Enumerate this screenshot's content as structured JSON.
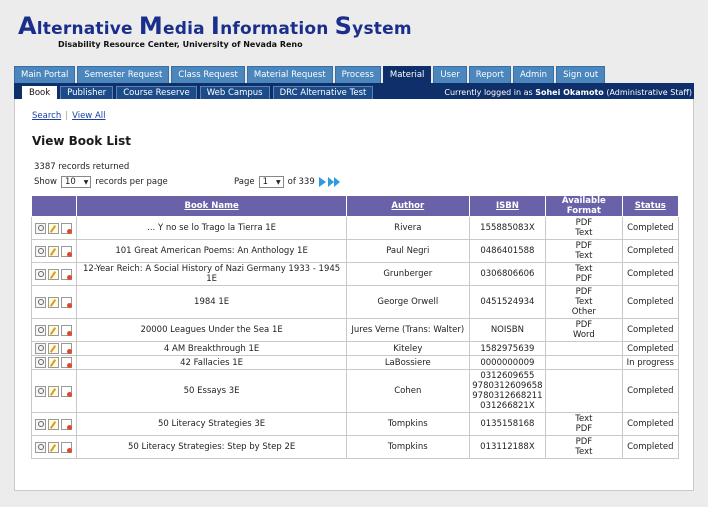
{
  "header": {
    "logo_words": [
      {
        "cap": "A",
        "rest": "lternative "
      },
      {
        "cap": "M",
        "rest": "edia "
      },
      {
        "cap": "I",
        "rest": "nformation "
      },
      {
        "cap": "S",
        "rest": "ystem"
      }
    ],
    "subtitle": "Disability Resource Center, University of Nevada Reno"
  },
  "main_tabs": [
    {
      "label": "Main Portal",
      "active": false
    },
    {
      "label": "Semester Request",
      "active": false
    },
    {
      "label": "Class Request",
      "active": false
    },
    {
      "label": "Material Request",
      "active": false
    },
    {
      "label": "Process",
      "active": false
    },
    {
      "label": "Material",
      "active": true
    },
    {
      "label": "User",
      "active": false
    },
    {
      "label": "Report",
      "active": false
    },
    {
      "label": "Admin",
      "active": false
    },
    {
      "label": "Sign out",
      "active": false
    }
  ],
  "sub_tabs": [
    {
      "label": "Book",
      "active": true
    },
    {
      "label": "Publisher",
      "active": false
    },
    {
      "label": "Course Reserve",
      "active": false
    },
    {
      "label": "Web Campus",
      "active": false
    },
    {
      "label": "DRC Alternative Test",
      "active": false
    }
  ],
  "login": {
    "prefix": "Currently logged in as",
    "user": "Sohei Okamoto",
    "role": "(Administrative Staff)"
  },
  "links": {
    "search": "Search",
    "view_all": "View All"
  },
  "page_title": "View Book List",
  "records": "3387 records returned",
  "paging": {
    "show_label": "Show",
    "per_page_value": "10",
    "per_page_label": "records per page",
    "page_label": "Page",
    "page_value": "1",
    "of_label": "of 339"
  },
  "table": {
    "headers": [
      "",
      "Book Name",
      "Author",
      "ISBN",
      "Available Format",
      "Status"
    ],
    "rows": [
      {
        "name": "... Y no se lo Trago la Tierra 1E",
        "author": "Rivera",
        "isbn": [
          "155885083X"
        ],
        "formats": [
          "PDF",
          "Text"
        ],
        "status": "Completed"
      },
      {
        "name": "101 Great American Poems: An Anthology 1E",
        "author": "Paul Negri",
        "isbn": [
          "0486401588"
        ],
        "formats": [
          "PDF",
          "Text"
        ],
        "status": "Completed"
      },
      {
        "name": "12-Year Reich: A Social History of Nazi Germany 1933 - 1945 1E",
        "author": "Grunberger",
        "isbn": [
          "0306806606"
        ],
        "formats": [
          "Text",
          "PDF"
        ],
        "status": "Completed"
      },
      {
        "name": "1984 1E",
        "author": "George Orwell",
        "isbn": [
          "0451524934"
        ],
        "formats": [
          "PDF",
          "Text",
          "Other"
        ],
        "status": "Completed"
      },
      {
        "name": "20000 Leagues Under the Sea 1E",
        "author": "Jures Verne (Trans: Walter)",
        "isbn": [
          "NOISBN"
        ],
        "formats": [
          "PDF",
          "Word"
        ],
        "status": "Completed"
      },
      {
        "name": "4 AM Breakthrough 1E",
        "author": "Kiteley",
        "isbn": [
          "1582975639"
        ],
        "formats": [],
        "status": "Completed"
      },
      {
        "name": "42 Fallacies 1E",
        "author": "LaBossiere",
        "isbn": [
          "0000000009"
        ],
        "formats": [],
        "status": "In progress"
      },
      {
        "name": "50 Essays 3E",
        "author": "Cohen",
        "isbn": [
          "0312609655",
          "9780312609658",
          "9780312668211",
          "031266821X"
        ],
        "formats": [],
        "status": "Completed"
      },
      {
        "name": "50 Literacy Strategies 3E",
        "author": "Tompkins",
        "isbn": [
          "0135158168"
        ],
        "formats": [
          "Text",
          "PDF"
        ],
        "status": "Completed"
      },
      {
        "name": "50 Literacy Strategies: Step by Step 2E",
        "author": "Tompkins",
        "isbn": [
          "013112188X"
        ],
        "formats": [
          "PDF",
          "Text"
        ],
        "status": "Completed"
      }
    ]
  },
  "colors": {
    "brand_blue": "#1a2f8c",
    "nav_dark": "#0f2f6a",
    "tab_blue": "#4b86bd",
    "table_header": "#6a62a8",
    "pager_arrow": "#2e9ae0"
  },
  "icons": {
    "row_actions": [
      "view-icon",
      "edit-icon",
      "delete-icon"
    ],
    "pager": [
      "next-page-icon",
      "last-page-icon"
    ]
  }
}
